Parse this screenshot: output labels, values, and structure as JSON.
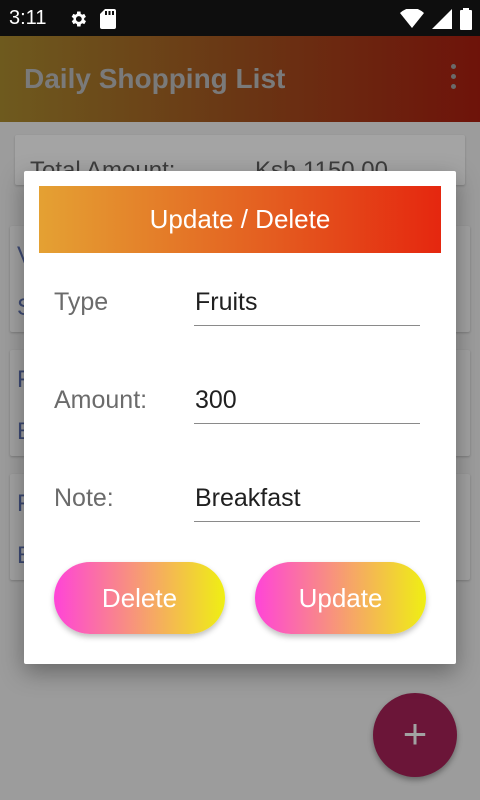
{
  "status_bar": {
    "time": "3:11"
  },
  "app_bar": {
    "title": "Daily Shopping List"
  },
  "summary": {
    "total_label": "Total Amount:",
    "total_value": "Ksh 1150.00"
  },
  "list_items": [
    {
      "top_text": "V",
      "bottom_text": "S"
    },
    {
      "top_text": "F",
      "bottom_text": "B"
    },
    {
      "top_text": "F",
      "bottom_text": "B"
    }
  ],
  "fab": {
    "label": "+"
  },
  "dialog": {
    "title": "Update / Delete",
    "fields": {
      "type": {
        "label": "Type",
        "value": "Fruits"
      },
      "amount": {
        "label": "Amount:",
        "value": "300"
      },
      "note": {
        "label": "Note:",
        "value": "Breakfast"
      }
    },
    "delete_label": "Delete",
    "update_label": "Update"
  },
  "colors": {
    "header_gradient": [
      "#e4a133",
      "#e5270f"
    ],
    "button_gradient": [
      "#ff44d8",
      "#efef13"
    ]
  }
}
